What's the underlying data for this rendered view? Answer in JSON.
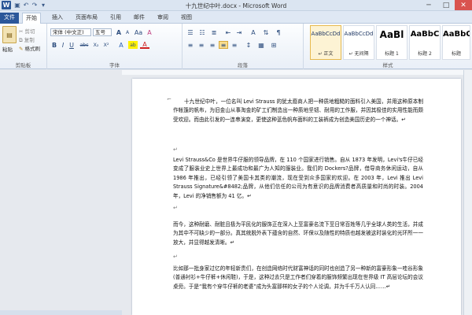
{
  "window": {
    "title": "十九世纪中叶.docx - Microsoft Word",
    "app_letter": "W"
  },
  "quick_access": {
    "save": "▣",
    "undo": "↶",
    "redo": "↷",
    "more": "▾"
  },
  "window_controls": {
    "minimize": "─",
    "maximize": "□",
    "close": "✕"
  },
  "tabs": [
    "文件",
    "开始",
    "插入",
    "页面布局",
    "引用",
    "邮件",
    "审阅",
    "视图"
  ],
  "ribbon": {
    "clipboard": {
      "label": "剪贴板",
      "paste": "粘贴",
      "cut": "剪切",
      "copy": "复制",
      "format_painter": "格式刷"
    },
    "font": {
      "label": "字体",
      "font_name": "宋体 (中文正)",
      "font_size": "五号",
      "bold": "B",
      "italic": "I",
      "underline": "U",
      "strike": "abc",
      "sub": "X₂",
      "sup": "X²",
      "clear": "A",
      "grow": "A",
      "shrink": "A",
      "change_case": "Aa",
      "highlight": "ab",
      "font_color": "A"
    },
    "paragraph": {
      "label": "段落"
    },
    "styles": {
      "label": "样式",
      "items": [
        {
          "sample": "AaBbCcDd",
          "name": "↵ 正文",
          "selected": true
        },
        {
          "sample": "AaBbCcDd",
          "name": "↵ 无间隔",
          "selected": false
        },
        {
          "sample": "AaBl",
          "name": "标题 1",
          "selected": false
        },
        {
          "sample": "AaBbC",
          "name": "标题 2",
          "selected": false
        },
        {
          "sample": "AaBbC",
          "name": "标题",
          "selected": false
        }
      ]
    }
  },
  "document": {
    "paragraphs": [
      "十九世纪中叶，一位名叫 Levi Strauss 的犹太裔商人把一种质地粗糙的面料引入美国，并用这种原本制作帐篷的帆布，为旧金山从事淘金的矿工们制造出一种质地坚韧、耐用的工作服，并因其极佳的实用性能而颇受欢迎。而由此引发的一连串演变，更使这种蓝色帆布面料的工装裤成为创造美国历史的一个神话。↵",
      "Levi Strauss&Co 是世界牛仔服的领导品牌，在 110 个国家进行销售。自从 1873 年发明，Levi's牛仔已经变成了服装业史上世界上最成功和最广为人知的服装业。我们的 Dockers?品牌，借导商务休闲运动，自从 1986 年推出，已经引领了美国卡其类的潮流，现在受到众多国家的欢迎。在 2003 年，Levi 推出 Levi Strauss Signature&#8482;品牌，从他们信任的公司为有意识的品牌消费者高质量和时尚的时装。2004 年，Levi 的净销售额为 41 亿。↵",
      "而今，这种耐磨、耐脏且极为平民化的服饰正在深入上至富豪名流下至日常百姓等几乎全球人类的生活，并成为其中不可缺少的一部分。真其统脱外表下蕴含的自然、环保以及随性的特质也越发被这时装化的光环所一一放大，并显得越发清晰。↵",
      "比如那一批身家过亿的年轻新贵们，在创造网络时代财富神话的同时也创造了另一种新的富豪形象一哇谷形象(普通衬衫+牛仔裤+休闲鞋)，于是，这种过去只是工作者们穿着的服饰频繁出现在世界级 IT 高层论坛的会议桌旁。于是“我有个穿牛仔裤的老婆”成为头富那样的女子的个人论调，并为千千万人认同……↵"
    ],
    "between_marks": [
      "↵",
      "↵",
      "↵"
    ]
  }
}
